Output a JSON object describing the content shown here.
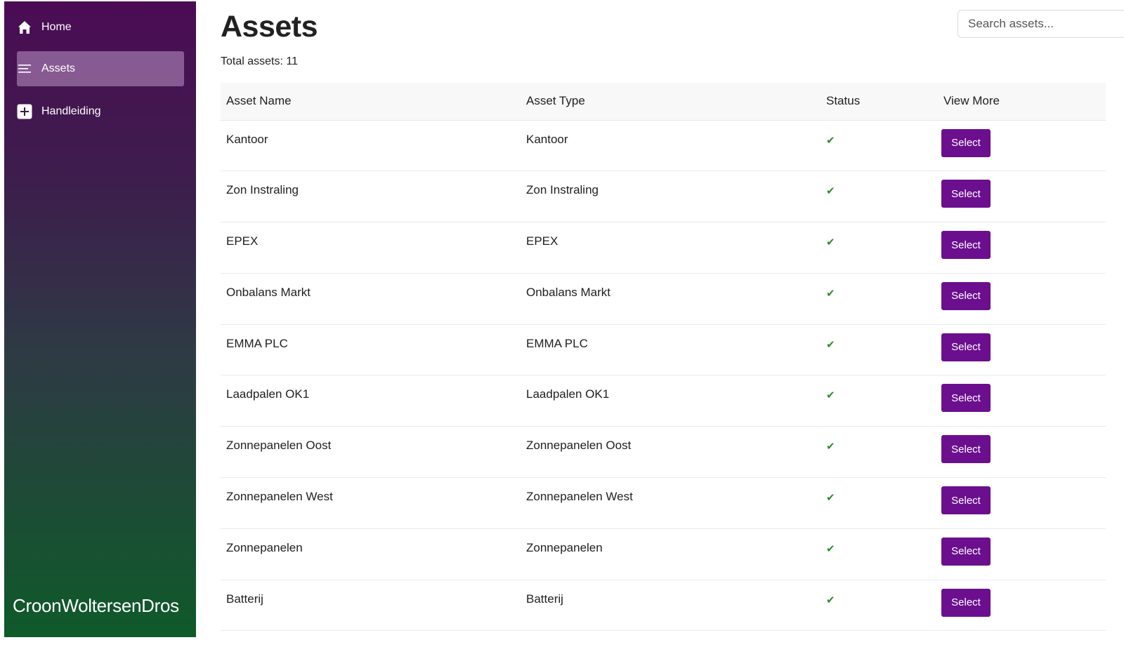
{
  "sidebar": {
    "items": [
      {
        "label": "Home",
        "icon": "home-icon",
        "active": false
      },
      {
        "label": "Assets",
        "icon": "list-icon",
        "active": true
      },
      {
        "label": "Handleiding",
        "icon": "plus-square-icon",
        "active": false
      }
    ],
    "brand": "CroonWoltersenDros",
    "gradient_colors": [
      "#4b0c55",
      "#0f5a2a"
    ]
  },
  "main": {
    "title": "Assets",
    "total_label": "Total assets: 11",
    "search": {
      "placeholder": "Search assets...",
      "value": ""
    },
    "table": {
      "headers": [
        "Asset Name",
        "Asset Type",
        "Status",
        "View More"
      ],
      "rows": [
        {
          "name": "Kantoor",
          "type": "Kantoor",
          "status": "✔",
          "action": "Select"
        },
        {
          "name": "Zon Instraling",
          "type": "Zon Instraling",
          "status": "✔",
          "action": "Select"
        },
        {
          "name": "EPEX",
          "type": "EPEX",
          "status": "✔",
          "action": "Select"
        },
        {
          "name": "Onbalans Markt",
          "type": "Onbalans Markt",
          "status": "✔",
          "action": "Select"
        },
        {
          "name": "EMMA PLC",
          "type": "EMMA PLC",
          "status": "✔",
          "action": "Select"
        },
        {
          "name": "Laadpalen OK1",
          "type": "Laadpalen OK1",
          "status": "✔",
          "action": "Select"
        },
        {
          "name": "Zonnepanelen Oost",
          "type": "Zonnepanelen Oost",
          "status": "✔",
          "action": "Select"
        },
        {
          "name": "Zonnepanelen West",
          "type": "Zonnepanelen West",
          "status": "✔",
          "action": "Select"
        },
        {
          "name": "Zonnepanelen",
          "type": "Zonnepanelen",
          "status": "✔",
          "action": "Select"
        },
        {
          "name": "Batterij",
          "type": "Batterij",
          "status": "✔",
          "action": "Select"
        }
      ]
    },
    "accent_color": "#6b0f8f",
    "status_color": "#2e8b2e"
  }
}
